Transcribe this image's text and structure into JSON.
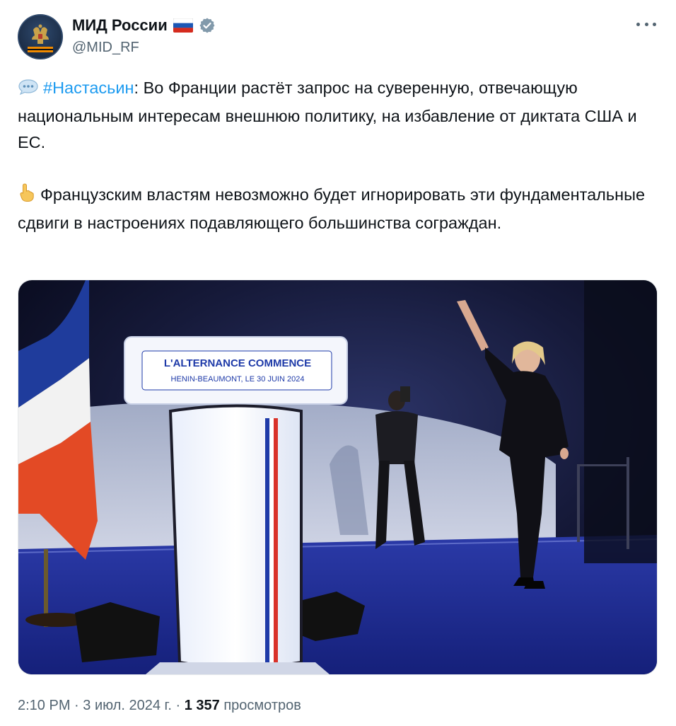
{
  "author": {
    "display_name": "МИД России",
    "handle": "@MID_RF",
    "flag_icon": "russia-flag-icon",
    "verified_icon": "verified-badge-icon",
    "verified_color": "#829aab"
  },
  "menu": {
    "more_icon": "more-horizontal-icon"
  },
  "post": {
    "paragraph1": {
      "emoji_icon": "speech-balloon-icon",
      "hashtag": "#Настасьин",
      "text": ": Во Франции растёт запрос на суверенную, отвечающую национальным интересам внешнюю политику, на избавление от диктата США и ЕС."
    },
    "paragraph2": {
      "emoji_icon": "pointing-up-hand-icon",
      "text": "Французским властям невозможно будет игнорировать эти фундаментальные сдвиги в настроениях подавляющего большинства сограждан."
    },
    "hashtag_color": "#1d9bf0"
  },
  "media": {
    "podium_title": "L'ALTERNANCE COMMENCE",
    "podium_subtitle": "HENIN-BEAUMONT, LE 30 JUIN 2024"
  },
  "meta": {
    "time": "2:10 PM",
    "separator": " · ",
    "date": "3 июл. 2024 г.",
    "views_count": "1 357",
    "views_label": " просмотров"
  }
}
